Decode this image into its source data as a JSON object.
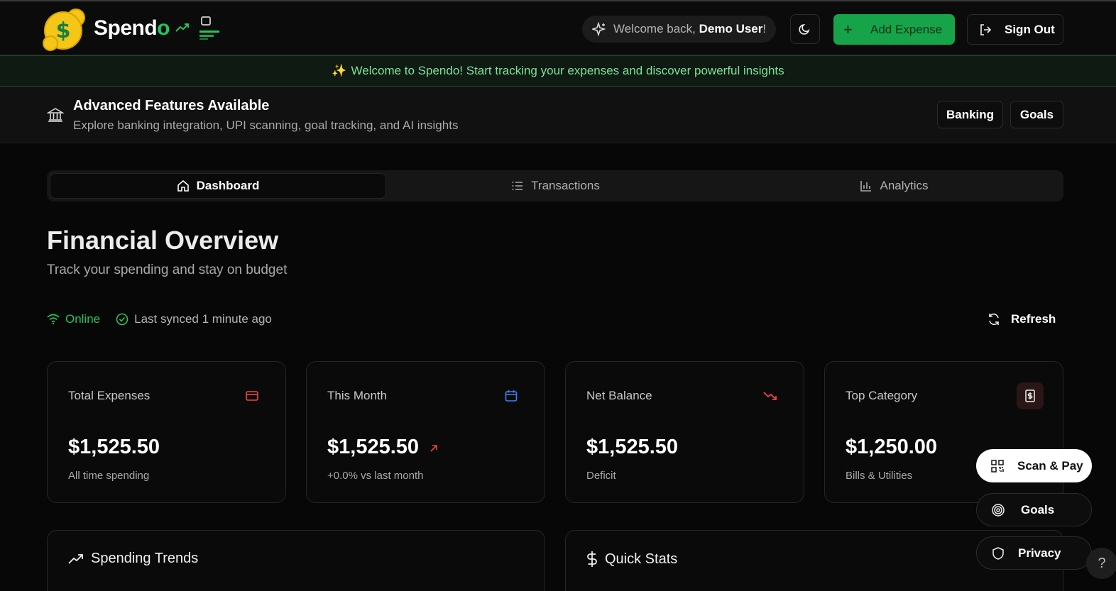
{
  "header": {
    "brand_main": "Spend",
    "brand_accent": "o",
    "welcome_prefix": "Welcome back, ",
    "welcome_user": "Demo User",
    "welcome_suffix": "!",
    "add_expense_label": "Add Expense",
    "sign_out_label": "Sign Out"
  },
  "banner": {
    "text": "Welcome to Spendo! Start tracking your expenses and discover powerful insights"
  },
  "features": {
    "title": "Advanced Features Available",
    "subtitle": "Explore banking integration, UPI scanning, goal tracking, and AI insights",
    "banking_label": "Banking",
    "goals_label": "Goals"
  },
  "tabs": [
    {
      "label": "Dashboard",
      "active": true
    },
    {
      "label": "Transactions",
      "active": false
    },
    {
      "label": "Analytics",
      "active": false
    }
  ],
  "overview": {
    "title": "Financial Overview",
    "subtitle": "Track your spending and stay on budget",
    "online": "Online",
    "synced": "Last synced 1 minute ago",
    "refresh": "Refresh"
  },
  "cards": [
    {
      "title": "Total Expenses",
      "value": "$1,525.50",
      "note": "All time spending",
      "icon": "credit-card-icon",
      "color": "#ef4444"
    },
    {
      "title": "This Month",
      "value": "$1,525.50",
      "note": "+0.0% vs last month",
      "icon": "calendar-icon",
      "color": "#3b82f6"
    },
    {
      "title": "Net Balance",
      "value": "$1,525.50",
      "note": "Deficit",
      "icon": "trend-down-icon",
      "color": "#ef4444"
    },
    {
      "title": "Top Category",
      "value": "$1,250.00",
      "note": "Bills & Utilities",
      "icon": "receipt-icon",
      "color": "#ef4444"
    }
  ],
  "sections": {
    "trends_title": "Spending Trends",
    "quick_stats_title": "Quick Stats"
  },
  "fabs": {
    "scan_label": "Scan & Pay",
    "goals_label": "Goals",
    "privacy_label": "Privacy"
  },
  "help": "?"
}
